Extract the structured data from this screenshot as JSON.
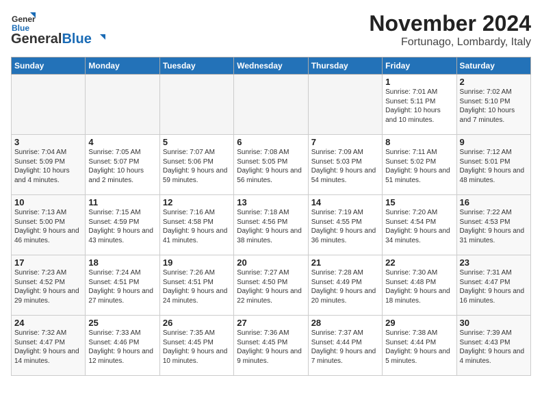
{
  "header": {
    "logo_general": "General",
    "logo_blue": "Blue",
    "month_title": "November 2024",
    "location": "Fortunago, Lombardy, Italy"
  },
  "days_of_week": [
    "Sunday",
    "Monday",
    "Tuesday",
    "Wednesday",
    "Thursday",
    "Friday",
    "Saturday"
  ],
  "weeks": [
    [
      {
        "day": "",
        "empty": true
      },
      {
        "day": "",
        "empty": true
      },
      {
        "day": "",
        "empty": true
      },
      {
        "day": "",
        "empty": true
      },
      {
        "day": "",
        "empty": true
      },
      {
        "day": "1",
        "info": "Sunrise: 7:01 AM\nSunset: 5:11 PM\nDaylight: 10 hours and 10 minutes."
      },
      {
        "day": "2",
        "info": "Sunrise: 7:02 AM\nSunset: 5:10 PM\nDaylight: 10 hours and 7 minutes.",
        "weekend": true
      }
    ],
    [
      {
        "day": "3",
        "info": "Sunrise: 7:04 AM\nSunset: 5:09 PM\nDaylight: 10 hours and 4 minutes.",
        "weekend": true
      },
      {
        "day": "4",
        "info": "Sunrise: 7:05 AM\nSunset: 5:07 PM\nDaylight: 10 hours and 2 minutes."
      },
      {
        "day": "5",
        "info": "Sunrise: 7:07 AM\nSunset: 5:06 PM\nDaylight: 9 hours and 59 minutes."
      },
      {
        "day": "6",
        "info": "Sunrise: 7:08 AM\nSunset: 5:05 PM\nDaylight: 9 hours and 56 minutes."
      },
      {
        "day": "7",
        "info": "Sunrise: 7:09 AM\nSunset: 5:03 PM\nDaylight: 9 hours and 54 minutes."
      },
      {
        "day": "8",
        "info": "Sunrise: 7:11 AM\nSunset: 5:02 PM\nDaylight: 9 hours and 51 minutes."
      },
      {
        "day": "9",
        "info": "Sunrise: 7:12 AM\nSunset: 5:01 PM\nDaylight: 9 hours and 48 minutes.",
        "weekend": true
      }
    ],
    [
      {
        "day": "10",
        "info": "Sunrise: 7:13 AM\nSunset: 5:00 PM\nDaylight: 9 hours and 46 minutes.",
        "weekend": true
      },
      {
        "day": "11",
        "info": "Sunrise: 7:15 AM\nSunset: 4:59 PM\nDaylight: 9 hours and 43 minutes."
      },
      {
        "day": "12",
        "info": "Sunrise: 7:16 AM\nSunset: 4:58 PM\nDaylight: 9 hours and 41 minutes."
      },
      {
        "day": "13",
        "info": "Sunrise: 7:18 AM\nSunset: 4:56 PM\nDaylight: 9 hours and 38 minutes."
      },
      {
        "day": "14",
        "info": "Sunrise: 7:19 AM\nSunset: 4:55 PM\nDaylight: 9 hours and 36 minutes."
      },
      {
        "day": "15",
        "info": "Sunrise: 7:20 AM\nSunset: 4:54 PM\nDaylight: 9 hours and 34 minutes."
      },
      {
        "day": "16",
        "info": "Sunrise: 7:22 AM\nSunset: 4:53 PM\nDaylight: 9 hours and 31 minutes.",
        "weekend": true
      }
    ],
    [
      {
        "day": "17",
        "info": "Sunrise: 7:23 AM\nSunset: 4:52 PM\nDaylight: 9 hours and 29 minutes.",
        "weekend": true
      },
      {
        "day": "18",
        "info": "Sunrise: 7:24 AM\nSunset: 4:51 PM\nDaylight: 9 hours and 27 minutes."
      },
      {
        "day": "19",
        "info": "Sunrise: 7:26 AM\nSunset: 4:51 PM\nDaylight: 9 hours and 24 minutes."
      },
      {
        "day": "20",
        "info": "Sunrise: 7:27 AM\nSunset: 4:50 PM\nDaylight: 9 hours and 22 minutes."
      },
      {
        "day": "21",
        "info": "Sunrise: 7:28 AM\nSunset: 4:49 PM\nDaylight: 9 hours and 20 minutes."
      },
      {
        "day": "22",
        "info": "Sunrise: 7:30 AM\nSunset: 4:48 PM\nDaylight: 9 hours and 18 minutes."
      },
      {
        "day": "23",
        "info": "Sunrise: 7:31 AM\nSunset: 4:47 PM\nDaylight: 9 hours and 16 minutes.",
        "weekend": true
      }
    ],
    [
      {
        "day": "24",
        "info": "Sunrise: 7:32 AM\nSunset: 4:47 PM\nDaylight: 9 hours and 14 minutes.",
        "weekend": true
      },
      {
        "day": "25",
        "info": "Sunrise: 7:33 AM\nSunset: 4:46 PM\nDaylight: 9 hours and 12 minutes."
      },
      {
        "day": "26",
        "info": "Sunrise: 7:35 AM\nSunset: 4:45 PM\nDaylight: 9 hours and 10 minutes."
      },
      {
        "day": "27",
        "info": "Sunrise: 7:36 AM\nSunset: 4:45 PM\nDaylight: 9 hours and 9 minutes."
      },
      {
        "day": "28",
        "info": "Sunrise: 7:37 AM\nSunset: 4:44 PM\nDaylight: 9 hours and 7 minutes."
      },
      {
        "day": "29",
        "info": "Sunrise: 7:38 AM\nSunset: 4:44 PM\nDaylight: 9 hours and 5 minutes."
      },
      {
        "day": "30",
        "info": "Sunrise: 7:39 AM\nSunset: 4:43 PM\nDaylight: 9 hours and 4 minutes.",
        "weekend": true
      }
    ]
  ]
}
